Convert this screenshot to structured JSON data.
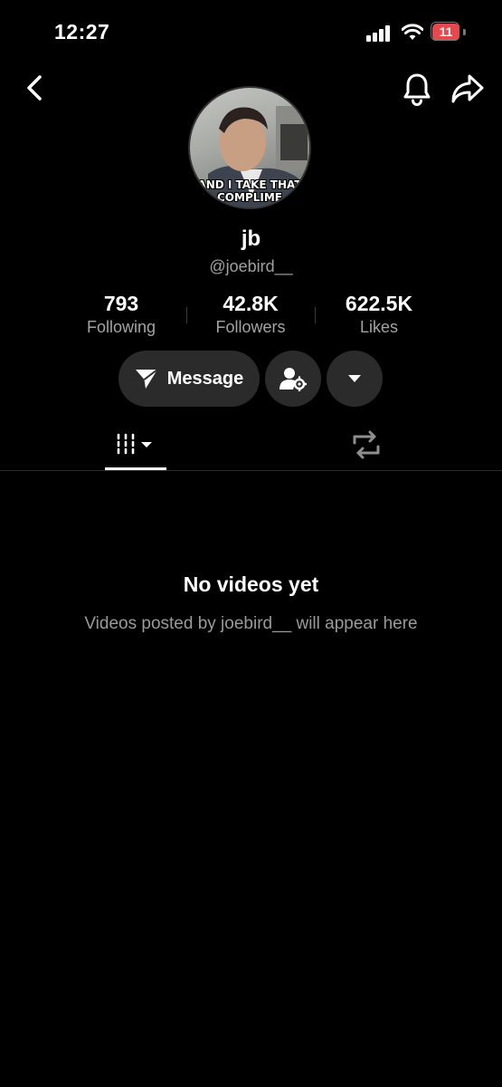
{
  "status_bar": {
    "time": "12:27",
    "battery": "11"
  },
  "profile": {
    "avatar_caption_line1": "AND I TAKE THAT",
    "avatar_caption_line2": "COMPLIME",
    "name": "jb",
    "username": "@joebird__"
  },
  "stats": [
    {
      "value": "793",
      "label": "Following"
    },
    {
      "value": "42.8K",
      "label": "Followers"
    },
    {
      "value": "622.5K",
      "label": "Likes"
    }
  ],
  "actions": {
    "message_label": "Message"
  },
  "empty_state": {
    "title": "No videos yet",
    "subtitle": "Videos posted by joebird__ will appear here"
  },
  "icons": {
    "back": "chevron-left-icon",
    "bell": "bell-icon",
    "share": "share-icon",
    "message": "send-icon",
    "add_friend": "user-settings-icon",
    "more": "caret-down-icon",
    "videos_tab": "grid-icon",
    "reposts_tab": "repost-icon"
  }
}
